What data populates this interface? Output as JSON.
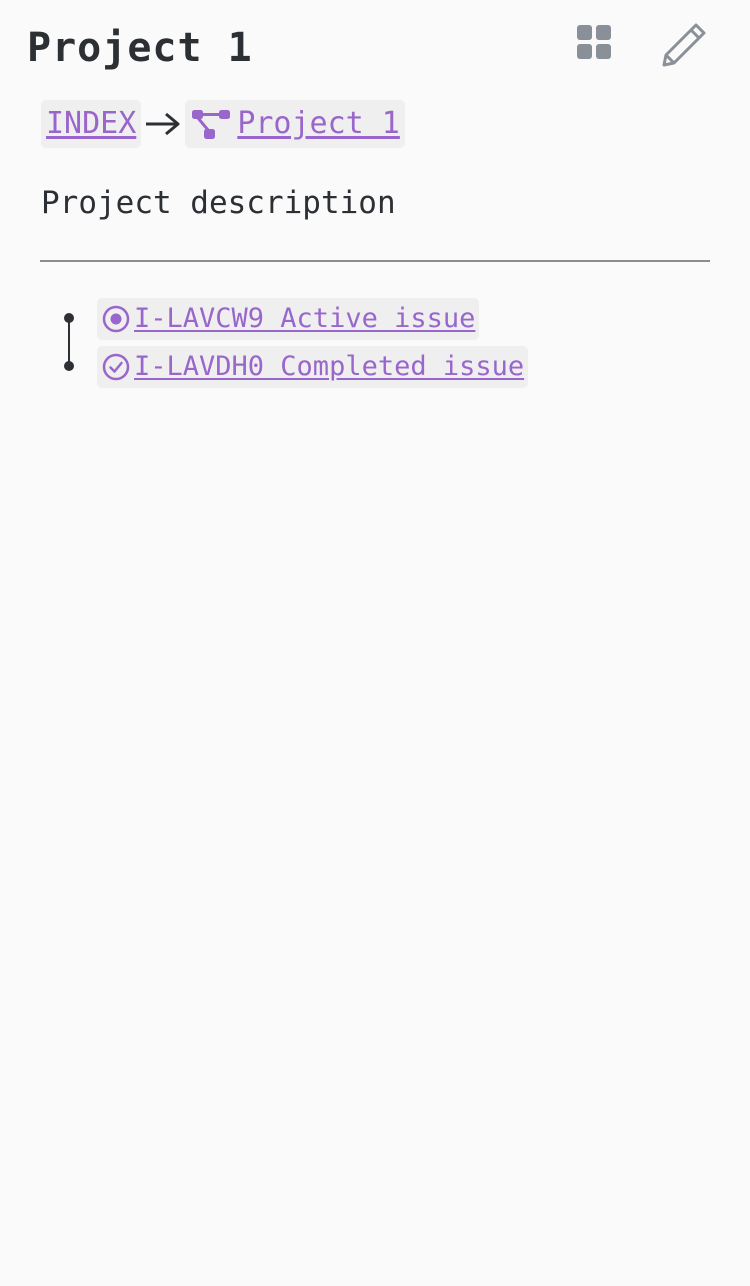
{
  "header": {
    "title": "Project 1",
    "grid_icon": "grid-icon",
    "edit_icon": "pencil-icon"
  },
  "breadcrumb": {
    "items": [
      {
        "label": "INDEX"
      },
      {
        "label": "Project 1",
        "icon": "project-tree-icon"
      }
    ],
    "separator_icon": "arrow-right-icon"
  },
  "description": "Project description",
  "issues": [
    {
      "label": "I-LAVCW9 Active issue",
      "status": "active",
      "icon": "active-issue-icon"
    },
    {
      "label": "I-LAVDH0 Completed issue",
      "status": "completed",
      "icon": "completed-issue-icon"
    }
  ],
  "colors": {
    "accent": "#9966cc",
    "text": "#2c2f33",
    "background": "#fafafa",
    "chip_background": "#efefef",
    "icon_gray": "#8a9098"
  }
}
